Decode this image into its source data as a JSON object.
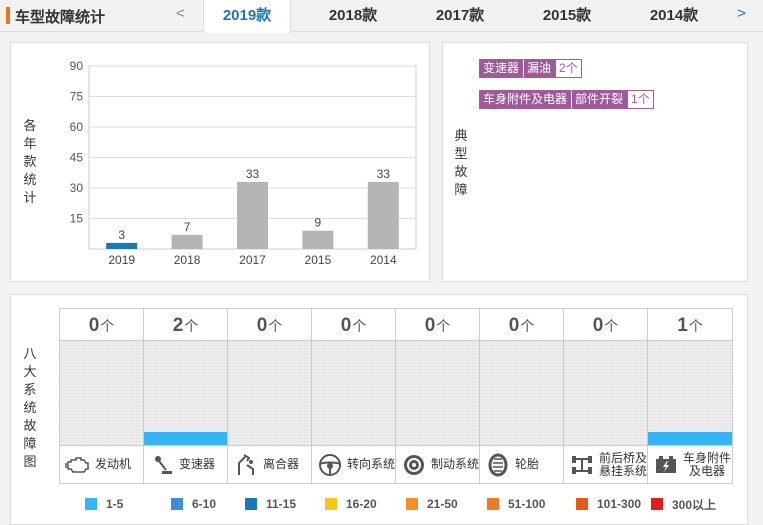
{
  "header": {
    "title": "车型故障统计",
    "prev_arrow": "<",
    "next_arrow": ">",
    "tabs": [
      {
        "label": "2019款",
        "active": true
      },
      {
        "label": "2018款",
        "active": false
      },
      {
        "label": "2017款",
        "active": false
      },
      {
        "label": "2015款",
        "active": false
      },
      {
        "label": "2014款",
        "active": false
      }
    ]
  },
  "stats_panel": {
    "vertical_label": [
      "各",
      "年",
      "款",
      "统",
      "计"
    ]
  },
  "chart_data": {
    "type": "bar",
    "categories": [
      "2019",
      "2018",
      "2017",
      "2015",
      "2014"
    ],
    "values": [
      3,
      7,
      33,
      9,
      33
    ],
    "ylim": [
      0,
      90
    ],
    "yticks": [
      15,
      30,
      45,
      60,
      75,
      90
    ],
    "grid": true,
    "highlight_category": "2019",
    "colors": {
      "highlight": "#1a78b4",
      "default": "#b5b5b5"
    }
  },
  "typical_faults": {
    "vertical_label": [
      "典",
      "型",
      "故",
      "障"
    ],
    "items": [
      {
        "component": "变速器",
        "symptom": "漏油",
        "count": "2个"
      },
      {
        "component": "车身附件及电器",
        "symptom": "部件开裂",
        "count": "1个"
      }
    ]
  },
  "systems_panel": {
    "vertical_label": [
      "八",
      "大",
      "系",
      "统",
      "故",
      "障",
      "图"
    ],
    "unit": "个",
    "max_scale": 5,
    "systems": [
      {
        "name": "发动机",
        "count": "0",
        "value": 0,
        "icon": "engine-icon"
      },
      {
        "name": "变速器",
        "count": "2",
        "value": 2,
        "icon": "gear-shift-icon"
      },
      {
        "name": "离合器",
        "count": "0",
        "value": 0,
        "icon": "clutch-pedal-icon"
      },
      {
        "name": "转向系统",
        "count": "0",
        "value": 0,
        "icon": "steering-wheel-icon"
      },
      {
        "name": "制动系统",
        "count": "0",
        "value": 0,
        "icon": "brake-disc-icon"
      },
      {
        "name": "轮胎",
        "count": "0",
        "value": 0,
        "icon": "tire-icon"
      },
      {
        "name": "前后桥及悬挂系统",
        "name_lines": [
          "前后桥及",
          "悬挂系统"
        ],
        "count": "0",
        "value": 0,
        "icon": "axle-suspension-icon"
      },
      {
        "name": "车身附件及电器",
        "name_lines": [
          "车身附件",
          "及电器"
        ],
        "count": "1",
        "value": 1,
        "icon": "battery-icon"
      }
    ]
  },
  "legend": [
    {
      "label": "1-5",
      "color": "#36b4f5"
    },
    {
      "label": "6-10",
      "color": "#3c8de0"
    },
    {
      "label": "11-15",
      "color": "#1a78b4"
    },
    {
      "label": "16-20",
      "color": "#f5c518"
    },
    {
      "label": "21-50",
      "color": "#f29022"
    },
    {
      "label": "51-100",
      "color": "#ef7b22"
    },
    {
      "label": "101-300",
      "color": "#e85a18"
    },
    {
      "label": "300以上",
      "color": "#e02020"
    }
  ]
}
